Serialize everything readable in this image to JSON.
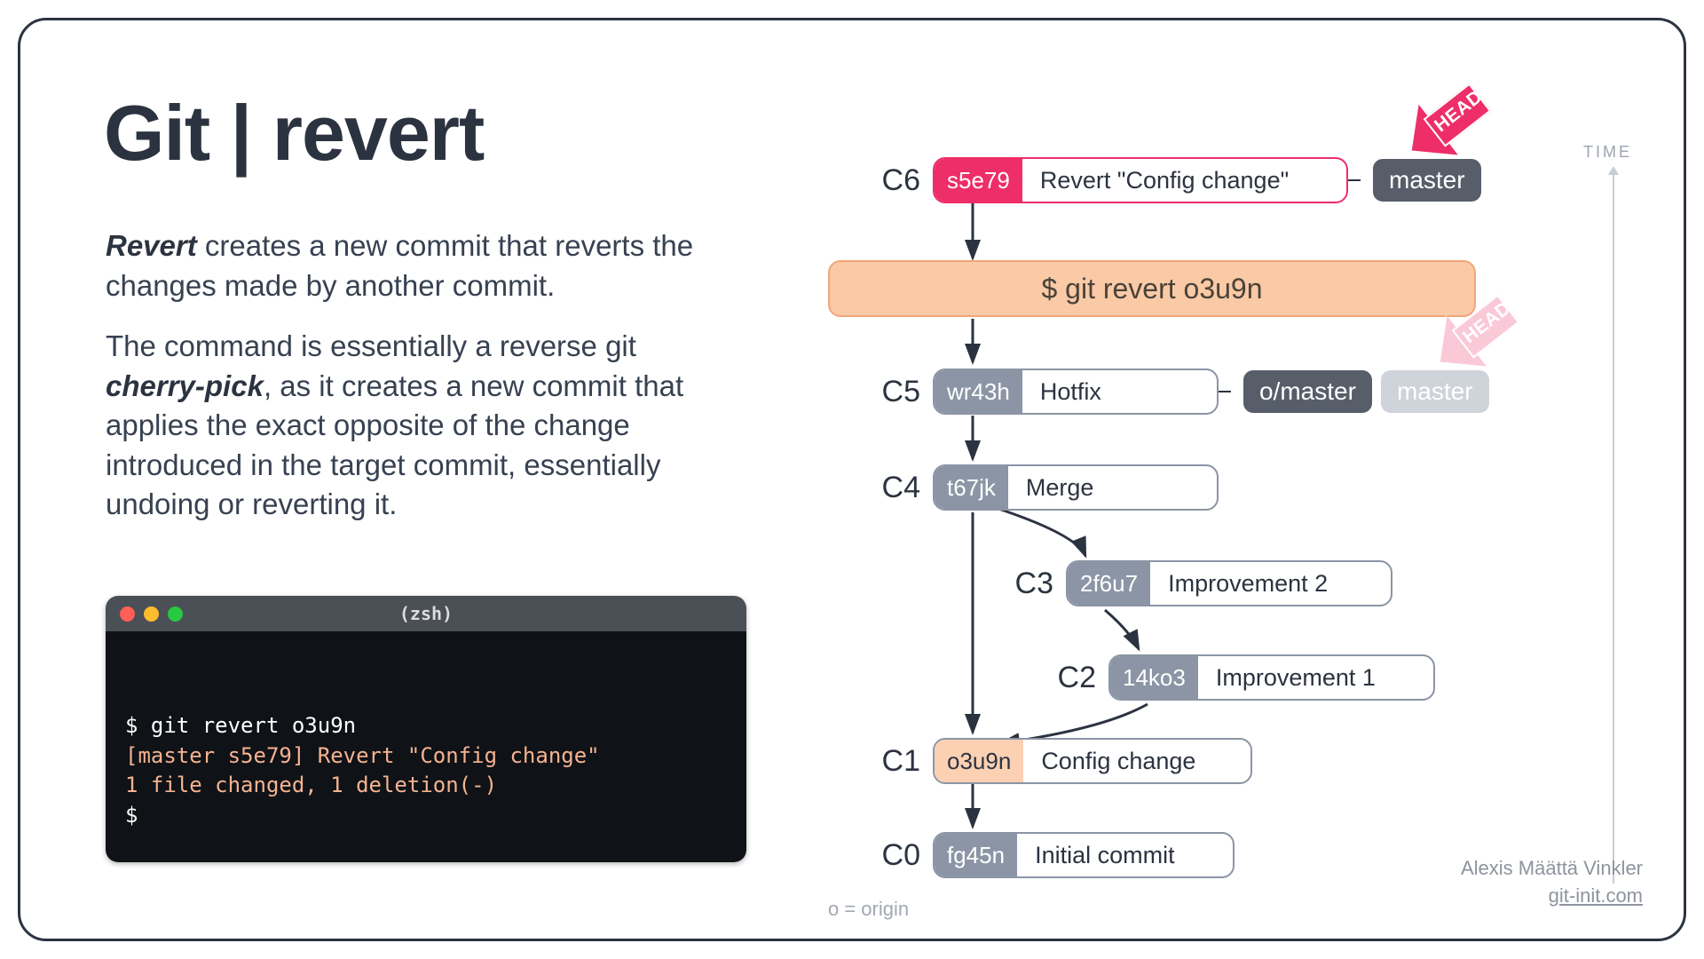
{
  "title": "Git | revert",
  "intro": {
    "strong1": "Revert",
    "p1_rest": " creates a new commit that reverts the changes made by another commit.",
    "p2_a": "The command is essentially a reverse git ",
    "strong2": "cherry-pick",
    "p2_b": ", as it creates a new commit that applies the exact opposite of the change introduced in the target commit, essentially undoing or reverting it."
  },
  "terminal": {
    "title": "(zsh)",
    "line1": "$ git revert o3u9n",
    "line2": "[master s5e79] Revert \"Config change\"",
    "line3": "1 file changed, 1 deletion(-)",
    "line4": "$"
  },
  "diagram": {
    "cmd": "$ git revert o3u9n",
    "commits": {
      "c6": {
        "label": "C6",
        "hash": "s5e79",
        "msg": "Revert \"Config change\""
      },
      "c5": {
        "label": "C5",
        "hash": "wr43h",
        "msg": "Hotfix"
      },
      "c4": {
        "label": "C4",
        "hash": "t67jk",
        "msg": "Merge"
      },
      "c3": {
        "label": "C3",
        "hash": "2f6u7",
        "msg": "Improvement 2"
      },
      "c2": {
        "label": "C2",
        "hash": "14ko3",
        "msg": "Improvement 1"
      },
      "c1": {
        "label": "C1",
        "hash": "o3u9n",
        "msg": "Config change"
      },
      "c0": {
        "label": "C0",
        "hash": "fg45n",
        "msg": "Initial commit"
      }
    },
    "tags": {
      "master": "master",
      "o_master": "o/master",
      "master_faded": "master",
      "head": "HEAD"
    },
    "time_label": "TIME",
    "legend": "o = origin"
  },
  "credit": {
    "name": "Alexis Määttä Vinkler",
    "url": "git-init.com"
  }
}
